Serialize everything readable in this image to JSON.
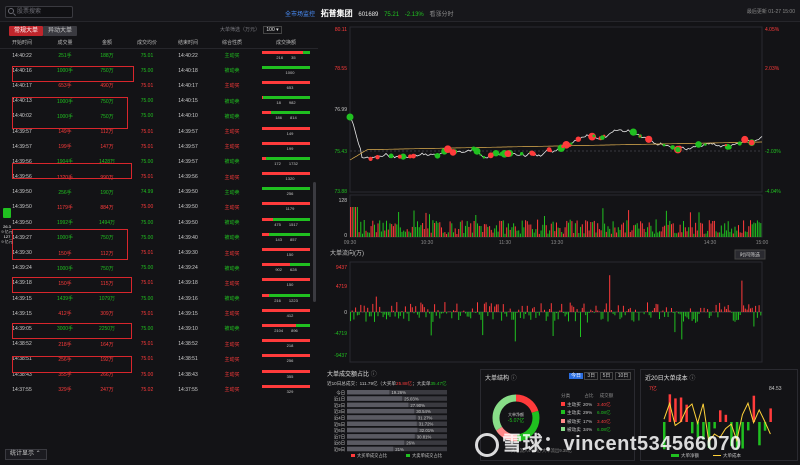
{
  "header": {
    "search_placeholder": "股票搜索",
    "title_prefix": "全市场监控",
    "stock_name": "拓普集团",
    "stock_code": "601689",
    "price": "75.21",
    "change": "-2.13%",
    "trend_label": "看涨分时",
    "last_update_label": "最后更新",
    "last_update_value": "01-27 15:00"
  },
  "left_tabs": [
    "常规大单",
    "异动大单"
  ],
  "filter": {
    "label": "大单筛选（万元）",
    "value": "100"
  },
  "table": {
    "headers": [
      "开始时间",
      "成交量",
      "金额",
      "成交均价",
      "结束时间",
      "综合性质",
      "成交换额"
    ],
    "rows": [
      {
        "start": "14:40:22",
        "vol": "251手",
        "amt": "188万",
        "avg": "75.01",
        "end": "14:40:22",
        "type": "主动买",
        "bar": [
          "216",
          "35"
        ],
        "c": "g"
      },
      {
        "start": "14:40:16",
        "vol": "1000手",
        "amt": "750万",
        "avg": "75.00",
        "end": "14:40:18",
        "type": "被动卖",
        "bar": [
          "",
          "1000"
        ],
        "c": "g"
      },
      {
        "start": "14:40:17",
        "vol": "653手",
        "amt": "490万",
        "avg": "75.01",
        "end": "14:40:17",
        "type": "主动买",
        "bar": [
          "",
          "653"
        ],
        "c": "r"
      },
      {
        "start": "14:40:13",
        "vol": "1000手",
        "amt": "750万",
        "avg": "75.00",
        "end": "14:40:15",
        "type": "被动卖",
        "bar": [
          "18",
          "982"
        ],
        "c": "g"
      },
      {
        "start": "14:40:02",
        "vol": "1000手",
        "amt": "750万",
        "avg": "75.00",
        "end": "14:40:10",
        "type": "被动卖",
        "bar": [
          "186",
          "814"
        ],
        "c": "g"
      },
      {
        "start": "14:39:57",
        "vol": "149手",
        "amt": "112万",
        "avg": "75.01",
        "end": "14:39:57",
        "type": "主动买",
        "bar": [
          "",
          "149"
        ],
        "c": "r"
      },
      {
        "start": "14:39:57",
        "vol": "199手",
        "amt": "147万",
        "avg": "75.01",
        "end": "14:39:57",
        "type": "主动买",
        "bar": [
          "",
          "199"
        ],
        "c": "r"
      },
      {
        "start": "14:39:56",
        "vol": "1904手",
        "amt": "1428万",
        "avg": "75.00",
        "end": "14:39:57",
        "type": "被动卖",
        "bar": [
          "172",
          "1732"
        ],
        "c": "g"
      },
      {
        "start": "14:39:56",
        "vol": "1320手",
        "amt": "990万",
        "avg": "75.01",
        "end": "14:39:56",
        "type": "主动买",
        "bar": [
          "",
          "1320"
        ],
        "c": "r"
      },
      {
        "start": "14:39:50",
        "vol": "256手",
        "amt": "190万",
        "avg": "74.99",
        "end": "14:39:50",
        "type": "主动卖",
        "bar": [
          "",
          "256"
        ],
        "c": "g"
      },
      {
        "start": "14:39:50",
        "vol": "1179手",
        "amt": "884万",
        "avg": "75.00",
        "end": "14:39:50",
        "type": "主动买",
        "bar": [
          "",
          "1179"
        ],
        "c": "r"
      },
      {
        "start": "14:39:50",
        "vol": "1992手",
        "amt": "1494万",
        "avg": "75.00",
        "end": "14:39:50",
        "type": "被动卖",
        "bar": [
          "475",
          "1517"
        ],
        "c": "g"
      },
      {
        "start": "14:39:27",
        "vol": "1000手",
        "amt": "750万",
        "avg": "75.00",
        "end": "14:39:40",
        "type": "被动卖",
        "bar": [
          "143",
          "857"
        ],
        "c": "g"
      },
      {
        "start": "14:39:30",
        "vol": "150手",
        "amt": "112万",
        "avg": "75.01",
        "end": "14:39:30",
        "type": "主动买",
        "bar": [
          "",
          "150"
        ],
        "c": "r"
      },
      {
        "start": "14:39:24",
        "vol": "1000手",
        "amt": "750万",
        "avg": "75.00",
        "end": "14:39:24",
        "type": "被动卖",
        "bar": [
          "902",
          "628"
        ],
        "c": "g"
      },
      {
        "start": "14:39:18",
        "vol": "150手",
        "amt": "115万",
        "avg": "75.01",
        "end": "14:39:18",
        "type": "主动买",
        "bar": [
          "",
          "150"
        ],
        "c": "r"
      },
      {
        "start": "14:39:15",
        "vol": "1439手",
        "amt": "1079万",
        "avg": "75.00",
        "end": "14:39:16",
        "type": "被动卖",
        "bar": [
          "216",
          "1223"
        ],
        "c": "g"
      },
      {
        "start": "14:39:15",
        "vol": "412手",
        "amt": "309万",
        "avg": "75.01",
        "end": "14:39:15",
        "type": "主动买",
        "bar": [
          "",
          "412"
        ],
        "c": "r"
      },
      {
        "start": "14:39:05",
        "vol": "3000手",
        "amt": "2250万",
        "avg": "75.00",
        "end": "14:39:10",
        "type": "被动卖",
        "bar": [
          "2104",
          "896"
        ],
        "c": "g"
      },
      {
        "start": "14:38:52",
        "vol": "218手",
        "amt": "164万",
        "avg": "75.01",
        "end": "14:38:52",
        "type": "主动买",
        "bar": [
          "",
          "218"
        ],
        "c": "r"
      },
      {
        "start": "14:38:51",
        "vol": "256手",
        "amt": "192万",
        "avg": "75.01",
        "end": "14:38:51",
        "type": "主动买",
        "bar": [
          "",
          "256"
        ],
        "c": "r"
      },
      {
        "start": "14:38:43",
        "vol": "355手",
        "amt": "266万",
        "avg": "75.00",
        "end": "14:38:43",
        "type": "主动买",
        "bar": [
          "",
          "355"
        ],
        "c": "r"
      },
      {
        "start": "14:37:55",
        "vol": "329手",
        "amt": "247万",
        "avg": "75.02",
        "end": "14:37:55",
        "type": "主动买",
        "bar": [
          "",
          "329"
        ],
        "c": "r"
      }
    ]
  },
  "footer_button": "统计显示",
  "side_widget": [
    "26.3",
    "9 亿元",
    "127",
    "9 亿元"
  ],
  "price_chart": {
    "y_left": [
      "80.11",
      "78.55",
      "76.99",
      "75.43",
      "73.88"
    ],
    "y_right": [
      "4.05%",
      "2.03%",
      "",
      "-2.03%",
      "-4.04%"
    ],
    "vol_y": [
      "128",
      "0"
    ],
    "times": [
      "09:30",
      "10:30",
      "11:30",
      "13:30",
      "14:30",
      "15:00"
    ],
    "flow_title": "大单流向(万)",
    "flow_button": "时间筛选",
    "flow_y": [
      "9437",
      "4719",
      "0",
      "-4719",
      "-9437"
    ]
  },
  "panel_ratio": {
    "title": "大单成交额占比",
    "summary": "近10日总成交：111.79亿（大买单",
    "summary_buy": "25.88亿",
    "summary_mid": "；大卖单",
    "summary_sell": "35.47亿",
    "days": [
      "今日",
      "近1日",
      "近2日",
      "近3日",
      "近4日",
      "近5日",
      "近6日",
      "近7日",
      "近8日",
      "近9日"
    ],
    "pcts": [
      "19.26%",
      "25.03%",
      "27.90%",
      "30.54%",
      "31.27%",
      "31.72%",
      "32.01%",
      "30.81%",
      "26%",
      "21%"
    ],
    "legend_buy": "大买单成交占比",
    "legend_sell": "大卖单成交占比"
  },
  "panel_struct": {
    "title": "大单结构",
    "tabs": [
      "今日",
      "3日",
      "5日",
      "10日"
    ],
    "donut_center": [
      "大单净额",
      "-5.07亿"
    ],
    "cols": [
      "分类",
      "占比",
      "成交额"
    ],
    "items": [
      {
        "name": "主动买",
        "pct": "20%",
        "amt": "3.40亿",
        "color": "#ff3b3b"
      },
      {
        "name": "主动卖",
        "pct": "29%",
        "amt": "6.08亿",
        "color": "#20c020"
      },
      {
        "name": "被动买",
        "pct": "17%",
        "amt": "3.40亿",
        "color": "#ff8888"
      },
      {
        "name": "被动卖",
        "pct": "34%",
        "amt": "6.08亿",
        "color": "#88dd88"
      }
    ],
    "footer": "大单流入4.28亿 大单流出9.35亿"
  },
  "panel_cost": {
    "title": "近20日大单成本",
    "y_left": "7亿",
    "y_right": "84.53",
    "legend_net": "大单净额",
    "legend_cost": "大单成本"
  },
  "watermark": {
    "text": "雪球：vincent534566070"
  }
}
